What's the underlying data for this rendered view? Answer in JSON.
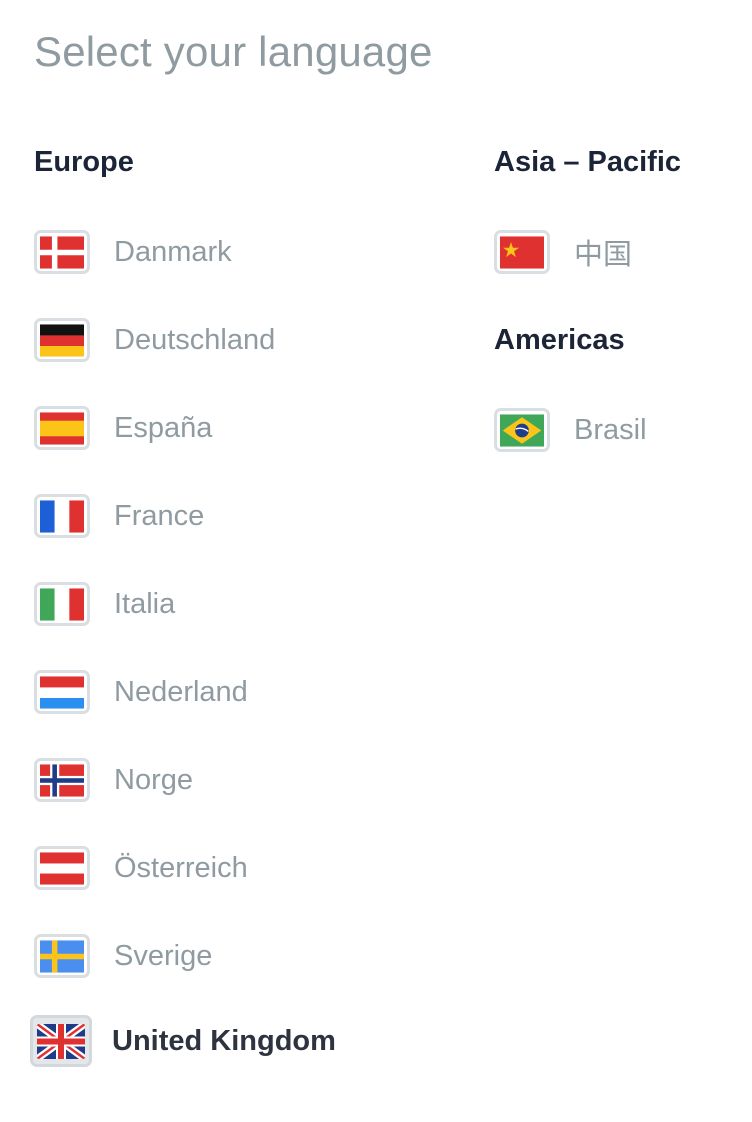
{
  "title": "Select your language",
  "regions": {
    "europe": {
      "heading": "Europe",
      "items": [
        {
          "label": "Danmark",
          "flag": "denmark-flag"
        },
        {
          "label": "Deutschland",
          "flag": "germany-flag"
        },
        {
          "label": "España",
          "flag": "spain-flag"
        },
        {
          "label": "France",
          "flag": "france-flag"
        },
        {
          "label": "Italia",
          "flag": "italy-flag"
        },
        {
          "label": "Nederland",
          "flag": "netherlands-flag"
        },
        {
          "label": "Norge",
          "flag": "norway-flag"
        },
        {
          "label": "Österreich",
          "flag": "austria-flag"
        },
        {
          "label": "Sverige",
          "flag": "sweden-flag"
        },
        {
          "label": "United Kingdom",
          "flag": "united-kingdom-flag",
          "selected": true
        }
      ]
    },
    "asia_pacific": {
      "heading": "Asia – Pacific",
      "items": [
        {
          "label": "中国",
          "flag": "china-flag"
        }
      ]
    },
    "americas": {
      "heading": "Americas",
      "items": [
        {
          "label": "Brasil",
          "flag": "brazil-flag"
        }
      ]
    }
  },
  "colors": {
    "title": "#8f9ba1",
    "heading": "#1c2438",
    "label": "#8f9ba1",
    "selected_label": "#2d3440",
    "flag_border": "#d9dee2"
  }
}
